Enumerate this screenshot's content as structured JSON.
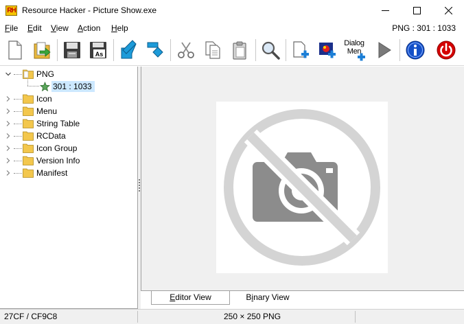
{
  "window": {
    "title": "Resource Hacker - Picture Show.exe",
    "app_icon_text": "RH"
  },
  "menu": {
    "items": [
      {
        "underline": "F",
        "rest": "ile"
      },
      {
        "underline": "E",
        "rest": "dit"
      },
      {
        "underline": "V",
        "rest": "iew"
      },
      {
        "underline": "A",
        "rest": "ction"
      },
      {
        "underline": "H",
        "rest": "elp"
      }
    ],
    "resource_info": "PNG : 301 : 1033"
  },
  "toolbar": {
    "dialog_label_line1": "Dialog",
    "dialog_label_line2": "Men"
  },
  "tree": {
    "expanded": {
      "label": "PNG"
    },
    "selected": {
      "label": "301 : 1033"
    },
    "items": [
      {
        "label": "Icon"
      },
      {
        "label": "Menu"
      },
      {
        "label": "String Table"
      },
      {
        "label": "RCData"
      },
      {
        "label": "Icon Group"
      },
      {
        "label": "Version Info"
      },
      {
        "label": "Manifest"
      }
    ]
  },
  "tabs": {
    "editor_underline": "E",
    "editor_rest": "ditor View",
    "binary_pre": "B",
    "binary_underline": "i",
    "binary_rest": "nary View"
  },
  "status": {
    "position": "27CF / CF9C8",
    "image_info": "250 × 250  PNG"
  },
  "colors": {
    "accent": "#0078d7",
    "selection": "#cce8ff",
    "folder": "#f3c74d",
    "power": "#d40000",
    "info": "#1450c8"
  }
}
